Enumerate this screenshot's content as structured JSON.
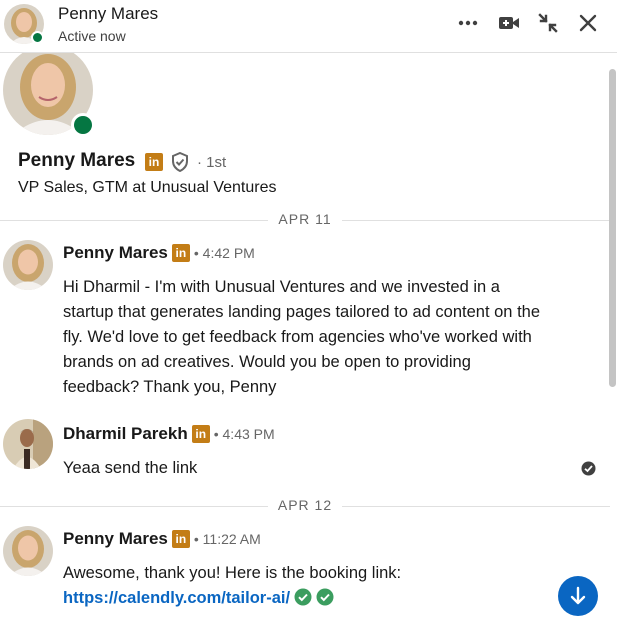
{
  "header": {
    "name": "Penny Mares",
    "status": "Active now",
    "actions": [
      "more-icon",
      "video-call-icon",
      "minimize-icon",
      "close-icon"
    ]
  },
  "profile": {
    "name": "Penny Mares",
    "badge": "in",
    "degree": "· 1st",
    "headline": "VP Sales, GTM at Unusual Ventures"
  },
  "conversation": [
    {
      "date": "APR 11",
      "messages": [
        {
          "sender": "Penny Mares",
          "badge": "in",
          "time": "• 4:42 PM",
          "text": "Hi Dharmil - I'm with Unusual Ventures and we invested in a startup that generates landing pages tailored to ad content on the fly. We'd love to get feedback from agencies who've worked with brands on ad creatives. Would you be open to providing feedback? Thank you, Penny"
        },
        {
          "sender": "Dharmil Parekh",
          "badge": "in",
          "time": "• 4:43 PM",
          "text": "Yeaa send the link"
        }
      ]
    },
    {
      "date": "APR 12",
      "messages": [
        {
          "sender": "Penny Mares",
          "badge": "in",
          "time": "• 11:22 AM",
          "text_prefix": "Awesome, thank you! Here is the booking link:",
          "link": "https://calendly.com/tailor-ai/"
        }
      ]
    }
  ],
  "colors": {
    "presence": "#057642",
    "link": "#0a66c2",
    "premium_badge": "#c37d16",
    "verified_check": "#3b9d5f"
  }
}
